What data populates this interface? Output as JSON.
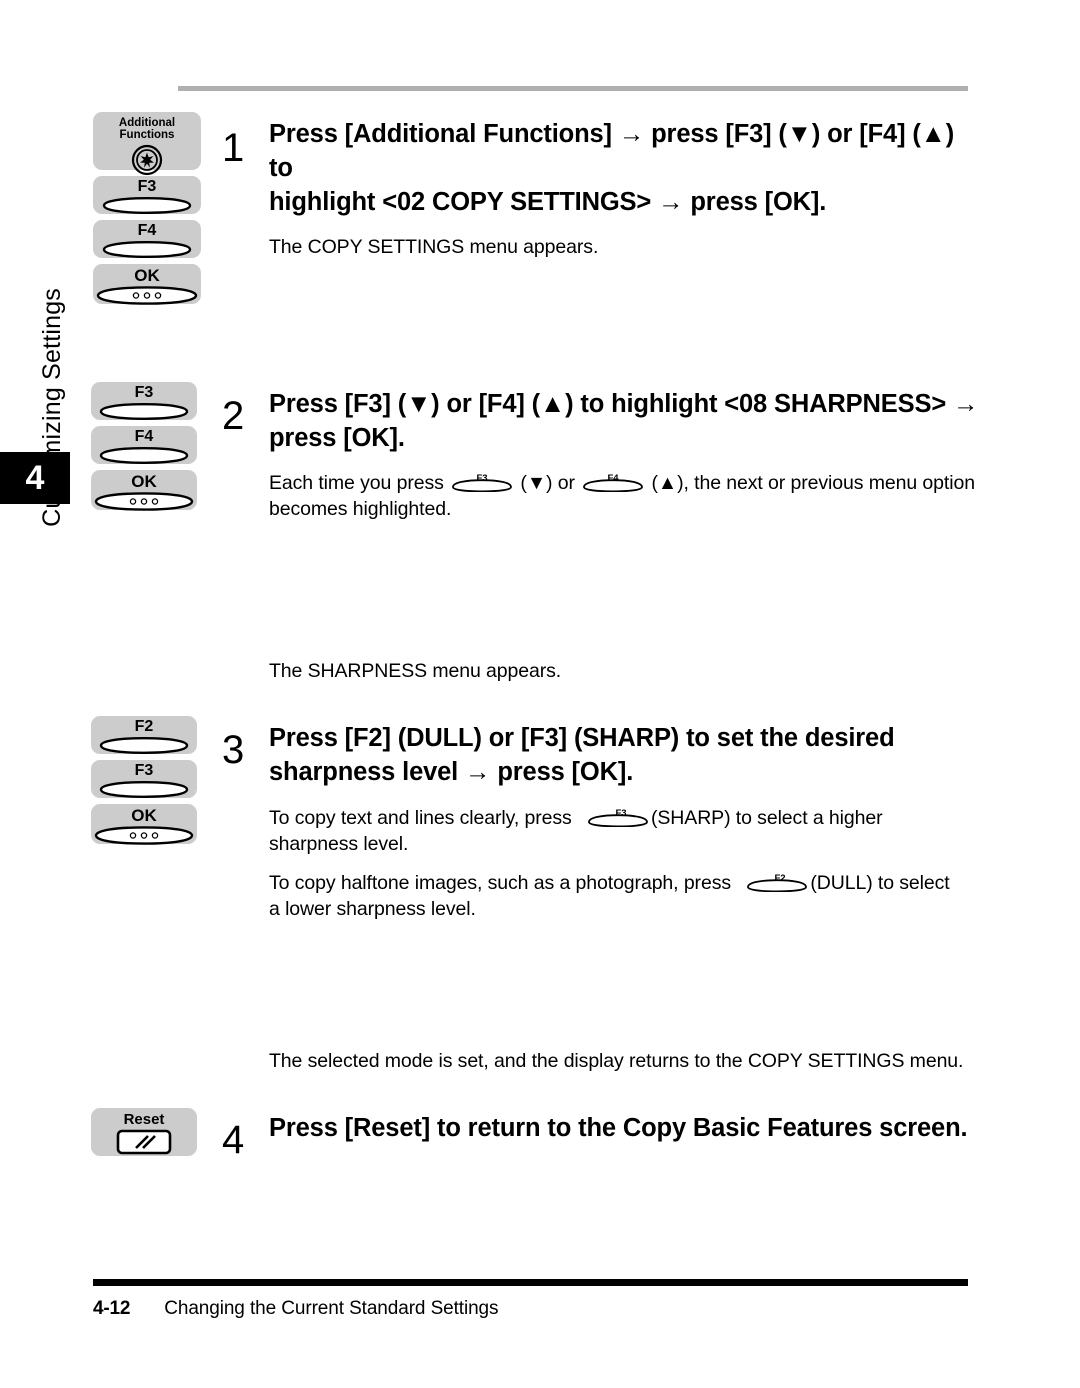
{
  "page": {
    "chapter_number": "4",
    "chapter_title": "Customizing Settings",
    "footer_page_number": "4-12",
    "footer_title": "Changing the Current Standard Settings"
  },
  "keys": {
    "additional_functions": "Additional Functions",
    "f2": "F2",
    "f3": "F3",
    "f4": "F4",
    "ok": "OK",
    "reset": "Reset"
  },
  "steps": [
    {
      "number": "1",
      "heading_line1": "Press [Additional Functions] → press [F3] (▼) or [F4] (▲) to",
      "heading_line2": "highlight <02 COPY SETTINGS> → press [OK].",
      "body_line1": "The COPY SETTINGS menu appears.",
      "key_illustrations": [
        "Additional Functions",
        "F3",
        "F4",
        "OK"
      ]
    },
    {
      "number": "2",
      "heading_line1": "Press [F3] (▼) or [F4] (▲) to highlight <08 SHARPNESS> →",
      "heading_line2": "press [OK].",
      "body_a": "Each time you press",
      "body_b": "(▼) or",
      "body_c": "(▲), the next or previous menu option",
      "body_d": "becomes highlighted.",
      "key_illustrations": [
        "F3",
        "F4",
        "OK"
      ]
    },
    {
      "number": "3",
      "heading_line1": "Press [F2] (DULL) or [F3] (SHARP) to set the desired",
      "heading_line2": "sharpness level → press [OK].",
      "body_a": "To copy text and lines clearly, press",
      "body_b": "(SHARP) to select a higher",
      "body_c": "sharpness level.",
      "body_d": "To copy halftone images, such as a photograph, press",
      "body_e": "(DULL) to select",
      "body_f": "a lower sharpness level.",
      "key_illustrations": [
        "F2",
        "F3",
        "OK"
      ]
    },
    {
      "number": "4",
      "heading_line1": "Press [Reset] to return to the Copy Basic Features screen.",
      "key_illustrations": [
        "Reset"
      ]
    }
  ],
  "notes": {
    "sharpness_menu": "The SHARPNESS menu appears.",
    "selected_mode": "The selected mode is set, and the display returns to the COPY SETTINGS menu."
  },
  "colors": {
    "keycap_background": "#cccccc",
    "top_rule": "#b0b0b0",
    "footer_rule": "#000000",
    "chapter_tab": "#000000"
  }
}
